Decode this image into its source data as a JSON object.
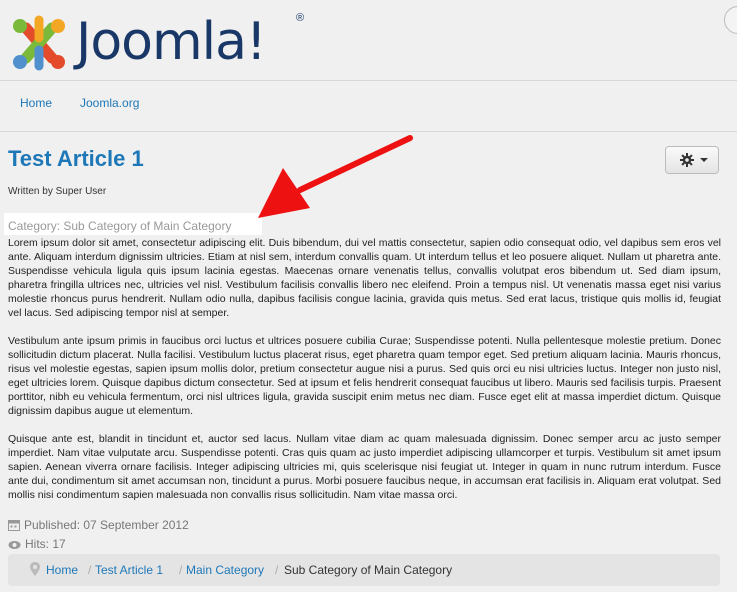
{
  "site": {
    "logo_text": "Joomla!",
    "registered_mark": "®"
  },
  "nav": {
    "items": [
      {
        "label": "Home"
      },
      {
        "label": "Joomla.org"
      }
    ]
  },
  "article": {
    "title": "Test Article 1",
    "author": "Written by Super User",
    "category": "Category: Sub Category of Main Category",
    "paragraphs": [
      "Lorem ipsum dolor sit amet, consectetur adipiscing elit. Duis bibendum, dui vel mattis consectetur, sapien odio consequat odio, vel dapibus sem eros vel ante. Aliquam interdum dignissim ultricies. Etiam at nisl sem, interdum convallis quam. Ut interdum tellus et leo posuere aliquet. Nullam ut pharetra ante. Suspendisse vehicula ligula quis ipsum lacinia egestas. Maecenas ornare venenatis tellus, convallis volutpat eros bibendum ut. Sed diam ipsum, pharetra fringilla ultrices nec, ultricies vel nisl. Vestibulum facilisis convallis libero nec eleifend. Proin a tempus nisl. Ut venenatis massa eget nisi varius molestie rhoncus purus hendrerit. Nullam odio nulla, dapibus facilisis congue lacinia, gravida quis metus. Sed erat lacus, tristique quis mollis id, feugiat vel lacus. Sed adipiscing tempor nisl at semper.",
      "Vestibulum ante ipsum primis in faucibus orci luctus et ultrices posuere cubilia Curae; Suspendisse potenti. Nulla pellentesque molestie pretium. Donec sollicitudin dictum placerat. Nulla facilisi. Vestibulum luctus placerat risus, eget pharetra quam tempor eget. Sed pretium aliquam lacinia. Mauris rhoncus, risus vel molestie egestas, sapien ipsum mollis dolor, pretium consectetur augue nisi a purus. Sed quis orci eu nisi ultricies luctus. Integer non justo nisl, eget ultricies lorem. Quisque dapibus dictum consectetur. Sed at ipsum et felis hendrerit consequat faucibus ut libero. Mauris sed facilisis turpis. Praesent porttitor, nibh eu vehicula fermentum, orci nisl ultrices ligula, gravida suscipit enim metus nec diam. Fusce eget elit at massa imperdiet dictum. Quisque dignissim dapibus augue ut elementum.",
      "Quisque ante est, blandit in tincidunt et, auctor sed lacus. Nullam vitae diam ac quam malesuada dignissim. Donec semper arcu ac justo semper imperdiet. Nam vitae vulputate arcu. Suspendisse potenti. Cras quis quam ac justo imperdiet adipiscing ullamcorper et turpis. Vestibulum sit amet ipsum sapien. Aenean viverra ornare facilisis. Integer adipiscing ultricies mi, quis scelerisque nisi feugiat ut. Integer in quam in nunc rutrum interdum. Fusce ante dui, condimentum sit amet accumsan non, tincidunt a purus. Morbi posuere faucibus neque, in accumsan erat facilisis in. Aliquam erat volutpat. Sed mollis nisi condimentum sapien malesuada non convallis risus sollicitudin. Nam vitae massa orci."
    ],
    "published": "Published: 07 September 2012",
    "hits": "Hits: 17"
  },
  "breadcrumb": {
    "items": [
      {
        "label": "Home"
      },
      {
        "label": "Test Article 1"
      },
      {
        "label": "Main Category"
      },
      {
        "label": "Sub Category of Main Category"
      }
    ],
    "separator": "/"
  },
  "colors": {
    "link": "#1e78b8",
    "logo_text": "#1a3867",
    "annotation_arrow": "#ee1111"
  },
  "icons": [
    "joomla-logo-icon",
    "gear-icon",
    "chevron-down-icon",
    "calendar-icon",
    "eye-icon",
    "map-pin-icon",
    "red-arrow-annotation"
  ]
}
